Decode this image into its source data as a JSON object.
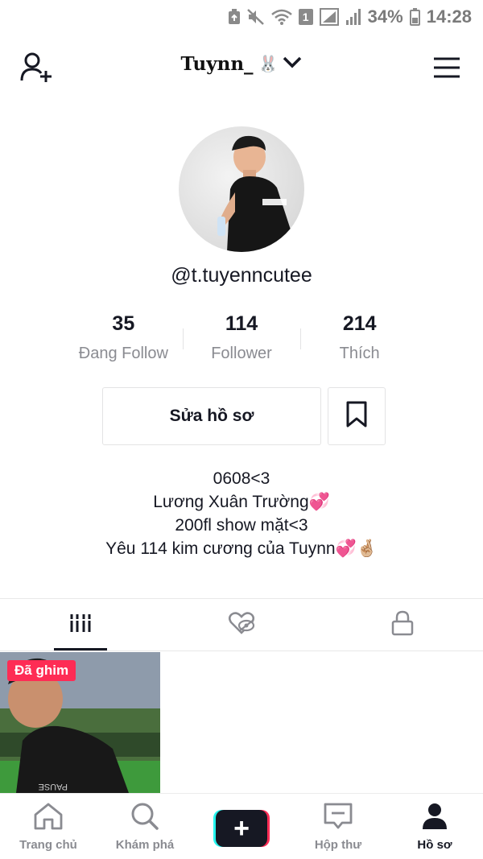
{
  "status_bar": {
    "battery_percent": "34%",
    "time": "14:28",
    "sim_badge": "1",
    "icons": [
      "alarm-icon",
      "mute-icon",
      "wifi-icon",
      "sim-badge-icon",
      "signal-icon",
      "signal-icon",
      "battery-icon"
    ]
  },
  "header": {
    "username": "Tuynn_",
    "username_emoji": "🐰",
    "icons": [
      "add-user-icon",
      "chevron-down-icon",
      "hamburger-menu-icon"
    ]
  },
  "profile": {
    "handle": "@t.tuyenncutee",
    "stats": [
      {
        "value": "35",
        "label": "Đang Follow"
      },
      {
        "value": "114",
        "label": "Follower"
      },
      {
        "value": "214",
        "label": "Thích"
      }
    ],
    "edit_button_label": "Sửa hồ sơ",
    "bio_lines": [
      "0608<3",
      "Lương Xuân Trường💞",
      "200fl show mặt<3",
      "Yêu 114 kim cương của Tuynn💞🤞🏼"
    ]
  },
  "tabs": {
    "icons": [
      "video-grid-icon",
      "liked-hidden-icon",
      "lock-icon"
    ],
    "active_index": 0
  },
  "videos": [
    {
      "badge": "Đã ghim"
    }
  ],
  "bottom_nav": {
    "items": [
      {
        "label": "Trang chủ",
        "icon": "home-icon"
      },
      {
        "label": "Khám phá",
        "icon": "search-icon"
      },
      {
        "label": "",
        "icon": "create-plus-icon"
      },
      {
        "label": "Hộp thư",
        "icon": "inbox-icon"
      },
      {
        "label": "Hồ sơ",
        "icon": "profile-icon"
      }
    ],
    "active_index": 4
  },
  "colors": {
    "accent_red": "#fe2c55",
    "accent_cyan": "#25f4ee",
    "text_primary": "#161823",
    "text_secondary": "#8a8b91"
  }
}
